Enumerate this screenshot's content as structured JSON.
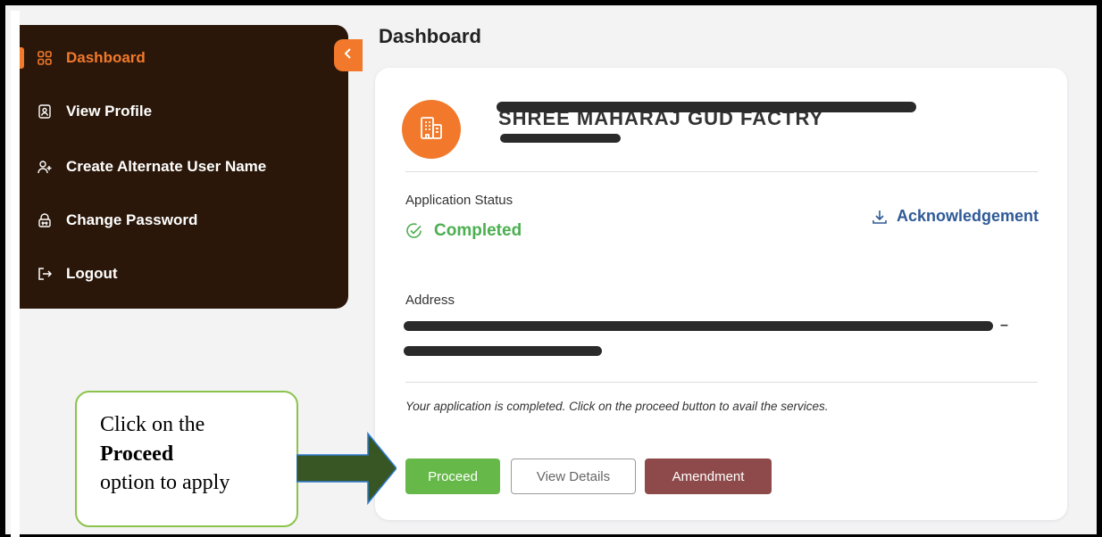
{
  "sidebar": {
    "items": [
      {
        "label": "Dashboard",
        "icon": "grid-icon",
        "active": true
      },
      {
        "label": "View Profile",
        "icon": "profile-icon"
      },
      {
        "label": "Create Alternate User Name",
        "icon": "add-user-icon"
      },
      {
        "label": "Change Password",
        "icon": "lock-icon"
      },
      {
        "label": "Logout",
        "icon": "logout-icon"
      }
    ]
  },
  "page": {
    "title": "Dashboard"
  },
  "card": {
    "name": "SHREE MAHARAJ GUD FACTRY",
    "status_label": "Application Status",
    "status_value": "Completed",
    "acknowledgement": "Acknowledgement",
    "address_label": "Address",
    "address_line2_suffix": "–",
    "info_message": "Your application is completed. Click on the proceed button to avail the services.",
    "buttons": {
      "proceed": "Proceed",
      "view_details": "View Details",
      "amendment": "Amendment"
    }
  },
  "callout": {
    "line1": "Click on the",
    "line2": "Proceed",
    "line3": "option to apply"
  },
  "colors": {
    "sidebar_bg": "#2a1709",
    "accent": "#f2792b",
    "success": "#4caf50",
    "link": "#2f5a96",
    "proceed": "#66b949",
    "amendment": "#8e4a4a",
    "arrow": "#375623"
  }
}
